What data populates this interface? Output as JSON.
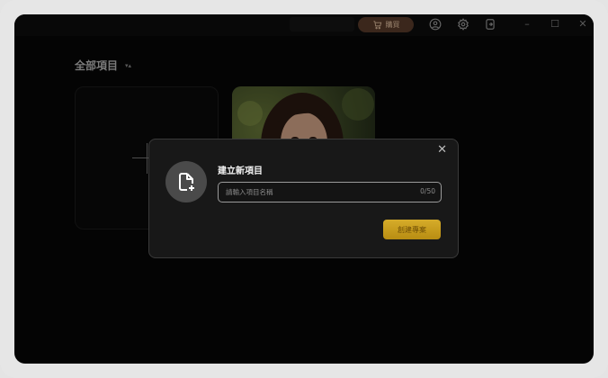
{
  "titlebar": {
    "shop_label": "購買",
    "icons": [
      "cart-icon",
      "user-icon",
      "gear-icon",
      "export-icon"
    ],
    "window_controls": {
      "minimize": "–",
      "maximize": "☐",
      "close": "✕"
    }
  },
  "main": {
    "section_title": "全部項目",
    "sort_icon": "▾▴",
    "projects": [
      {
        "type": "new",
        "icon": "plus-icon"
      },
      {
        "type": "thumbnail",
        "icon": "portrait-photo"
      }
    ]
  },
  "dialog": {
    "title": "建立新項目",
    "close_icon": "✕",
    "input_placeholder": "請輸入項目名稱",
    "input_value": "",
    "char_count": "0/50",
    "create_button": "創建專案"
  },
  "colors": {
    "background": "#070707",
    "accent_gold": "#d6ac2a",
    "shop_button": "#5b3c2c"
  }
}
